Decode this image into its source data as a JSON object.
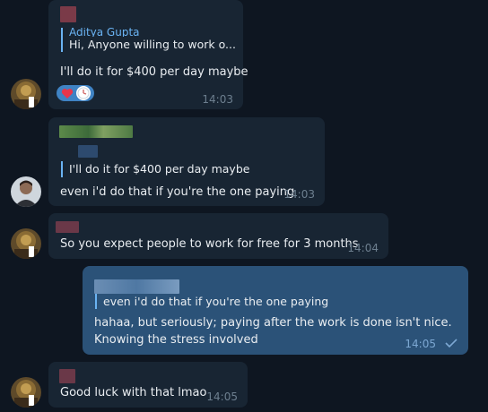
{
  "messages": [
    {
      "id": "m1",
      "reply_name": "Aditya Gupta",
      "reply_text": "Hi, Anyone willing to work o...",
      "text": "I'll do it for $400 per day maybe",
      "time": "14:03",
      "reactions": [
        "heart-icon",
        "clock-icon"
      ]
    },
    {
      "id": "m2",
      "reply_text": "I'll do it for $400 per day maybe",
      "text": "even i'd do that if you're the one paying",
      "time": "14:03"
    },
    {
      "id": "m3",
      "text": "So you expect people to work for free for 3 months",
      "time": "14:04"
    },
    {
      "id": "m4",
      "reply_text": "even i'd do that if you're the one paying",
      "text_line1": "hahaa, but seriously; paying after the work is done isn't nice.",
      "text_line2": "Knowing the stress involved",
      "time": "14:05",
      "status": "sent-check-icon"
    },
    {
      "id": "m5",
      "text": "Good luck with that lmao",
      "time": "14:05"
    }
  ],
  "colors": {
    "background": "#0e1621",
    "incoming_bubble": "#182533",
    "outgoing_bubble": "#2b5278",
    "accent": "#6ab3f3",
    "reaction_pill": "#3f83c4"
  }
}
